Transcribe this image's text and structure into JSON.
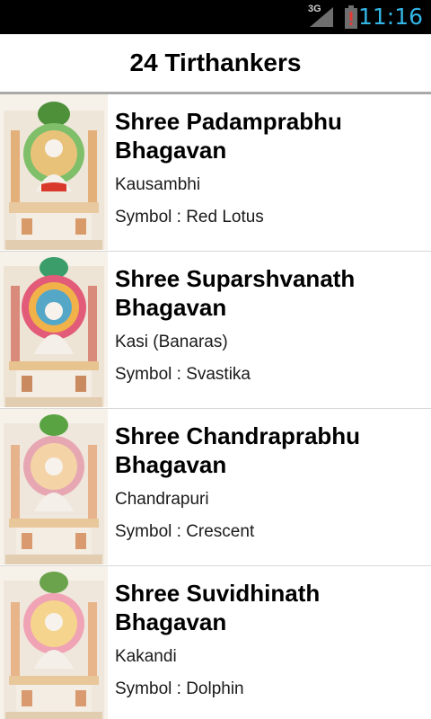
{
  "status_bar": {
    "network": "3G",
    "time": "11:16",
    "icons": [
      "signal-3g-icon",
      "battery-alert-icon"
    ]
  },
  "header": {
    "title": "24 Tirthankers"
  },
  "list": {
    "items": [
      {
        "name": "Shree Padamprabhu Bhagavan",
        "place": "Kausambhi",
        "symbol": "Symbol : Red Lotus",
        "halo_color": "#7fbf6a",
        "cloth_color": "#d8392b",
        "crest_color": "#4e8f3a"
      },
      {
        "name": "Shree Suparshvanath Bhagavan",
        "place": "Kasi (Banaras)",
        "symbol": "Symbol : Svastika",
        "halo_color": "#e25b78",
        "cloth_color": "#e8e4df",
        "crest_color": "#3b9e6a"
      },
      {
        "name": "Shree Chandraprabhu Bhagavan",
        "place": "Chandrapuri",
        "symbol": "Symbol : Crescent",
        "halo_color": "#e6a7b3",
        "cloth_color": "#eeeeee",
        "crest_color": "#5aa343"
      },
      {
        "name": "Shree Suvidhinath Bhagavan",
        "place": "Kakandi",
        "symbol": "Symbol : Dolphin",
        "halo_color": "#f0a3b5",
        "cloth_color": "#eeeeee",
        "crest_color": "#6ba34c"
      }
    ]
  }
}
